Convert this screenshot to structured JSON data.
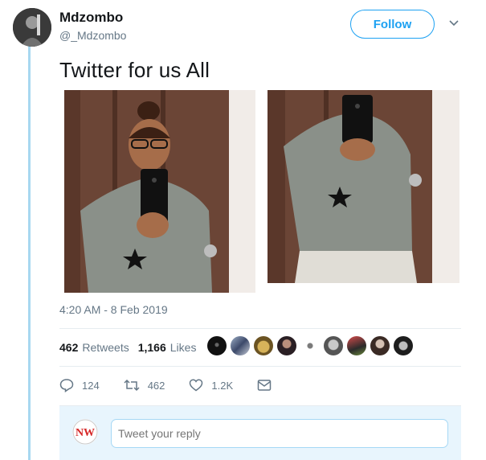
{
  "tweet": {
    "author_name": "Mdzombo",
    "author_handle": "@_Mdzombo",
    "follow_label": "Follow",
    "text": "Twitter for us All",
    "timestamp": "4:20 AM - 8 Feb 2019"
  },
  "stats": {
    "retweets_count": "462",
    "retweets_label": "Retweets",
    "likes_count": "1,166",
    "likes_label": "Likes"
  },
  "actions": {
    "reply_count": "124",
    "retweet_count": "462",
    "like_count": "1.2K"
  },
  "reply": {
    "placeholder": "Tweet your reply",
    "avatar_text": "NW"
  },
  "icons": {
    "chevron": "chevron-down-icon",
    "reply": "reply-icon",
    "retweet": "retweet-icon",
    "like": "heart-icon",
    "message": "envelope-icon"
  },
  "colors": {
    "accent": "#1da1f2",
    "text_secondary": "#657786",
    "thread_line": "#a7d8f0",
    "reply_background": "#e8f5fd"
  }
}
